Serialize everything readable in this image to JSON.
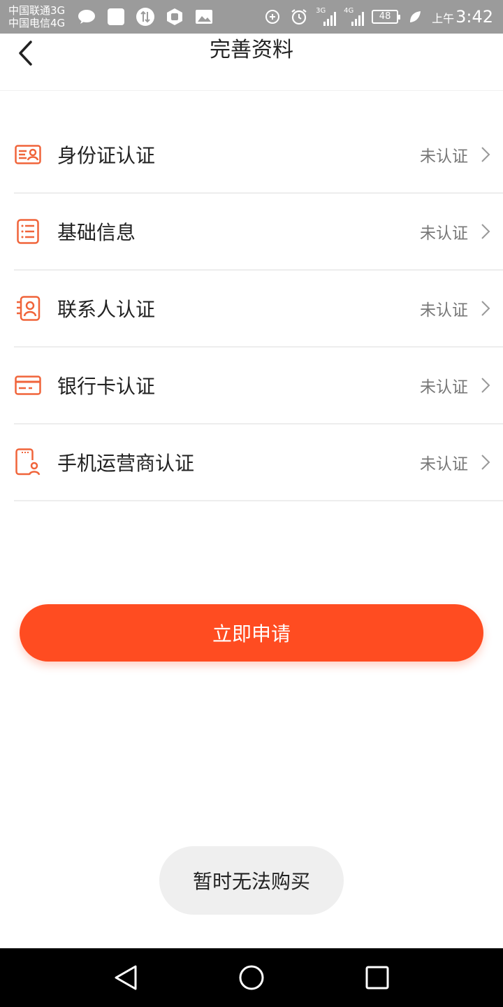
{
  "status_bar": {
    "carrier_1": "中国联通3G",
    "carrier_2": "中国电信4G",
    "net_1": "3G",
    "net_2": "4G",
    "battery": "48",
    "ampm": "上午",
    "time": "3:42"
  },
  "header": {
    "title": "完善资料"
  },
  "list": {
    "items": [
      {
        "label": "身份证认证",
        "status": "未认证",
        "icon": "id-card-icon"
      },
      {
        "label": "基础信息",
        "status": "未认证",
        "icon": "list-document-icon"
      },
      {
        "label": "联系人认证",
        "status": "未认证",
        "icon": "contact-card-icon"
      },
      {
        "label": "银行卡认证",
        "status": "未认证",
        "icon": "bank-card-icon"
      },
      {
        "label": "手机运营商认证",
        "status": "未认证",
        "icon": "phone-user-icon"
      }
    ]
  },
  "apply_button": {
    "label": "立即申请"
  },
  "toast": {
    "message": "暂时无法购买"
  },
  "colors": {
    "accent": "#ff4c21",
    "icon": "#f0643a",
    "status_bar": "#9b9b9b"
  }
}
